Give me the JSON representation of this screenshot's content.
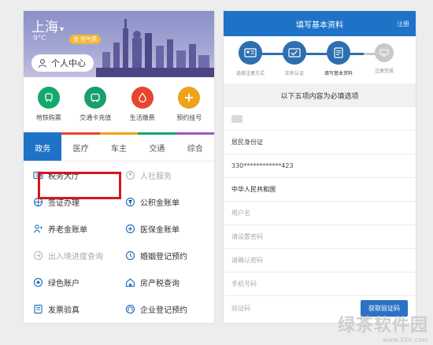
{
  "left": {
    "city": "上海",
    "temperature": "9°C",
    "air_badge": "良 空气质",
    "user_center": "个人中心",
    "services": [
      {
        "label": "地铁购票",
        "color": "#13a86c",
        "icon": "subway-icon"
      },
      {
        "label": "交通卡充值",
        "color": "#17a06b",
        "icon": "transit-card-icon"
      },
      {
        "label": "生活缴费",
        "color": "#e8452f",
        "icon": "utility-bill-icon"
      },
      {
        "label": "预约挂号",
        "color": "#f0a21b",
        "icon": "appointment-icon"
      }
    ],
    "color_bar": [
      "#1e73c8",
      "#e8452f",
      "#f0a21b",
      "#13a86c",
      "#9b59b6"
    ],
    "tabs": [
      "政务",
      "医疗",
      "车主",
      "交通",
      "综合"
    ],
    "grid": [
      [
        {
          "label": "税务大厅",
          "icon": "tax-hall-icon"
        },
        {
          "label": "人社服务",
          "icon": "social-service-icon",
          "dim": true
        }
      ],
      [
        {
          "label": "签证办理",
          "icon": "visa-icon"
        },
        {
          "label": "公积金账单",
          "icon": "fund-bill-icon"
        }
      ],
      [
        {
          "label": "养老金账单",
          "icon": "pension-icon"
        },
        {
          "label": "医保金账单",
          "icon": "medical-insurance-icon"
        }
      ],
      [
        {
          "label": "出入境进度查询",
          "icon": "immigration-icon",
          "dim": true
        },
        {
          "label": "婚姻登记预约",
          "icon": "marriage-icon"
        }
      ],
      [
        {
          "label": "绿色账户",
          "icon": "green-account-icon"
        },
        {
          "label": "房产税查询",
          "icon": "property-tax-icon"
        }
      ],
      [
        {
          "label": "发票验真",
          "icon": "invoice-icon"
        },
        {
          "label": "企业登记预约",
          "icon": "enterprise-icon"
        }
      ]
    ]
  },
  "right": {
    "header_title": "填写基本资料",
    "cancel": "注册",
    "steps": [
      "选择注册方式",
      "实名认证",
      "填写基本资料",
      "注册完成"
    ],
    "notice": "以下五项内容为必填选项",
    "fields": [
      {
        "text": "",
        "style": "blur"
      },
      {
        "text": "居民身份证",
        "style": "value"
      },
      {
        "text": "330************423",
        "style": "value"
      },
      {
        "text": "中华人民共和国",
        "style": "bold"
      },
      {
        "text": "用户名",
        "style": "ph"
      },
      {
        "text": "请设置密码",
        "style": "ph"
      },
      {
        "text": "请确认密码",
        "style": "ph"
      },
      {
        "text": "手机号码",
        "style": "ph"
      },
      {
        "text": "验证码",
        "style": "ph"
      }
    ],
    "sms_button": "获取验证码"
  },
  "watermark": {
    "main": "绿茶软件园",
    "sub": "www.33lc.com"
  }
}
